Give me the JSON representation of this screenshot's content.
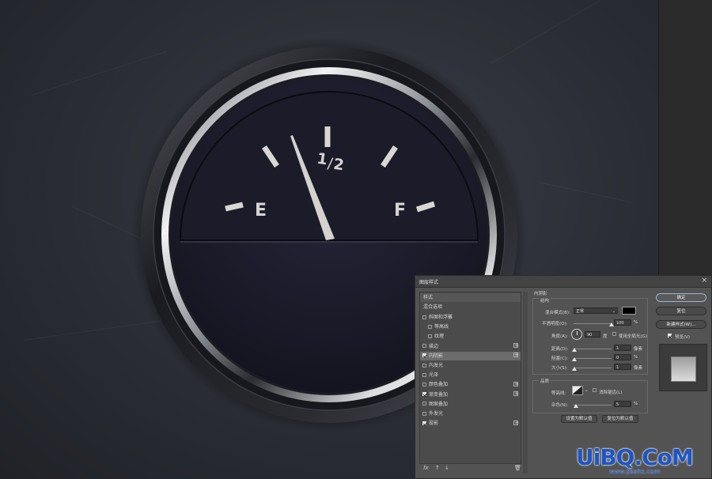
{
  "gauge": {
    "empty_label": "E",
    "full_label": "F",
    "half_numerator": "1",
    "half_slash": "/",
    "half_denominator": "2",
    "needle_level": 0.44
  },
  "dialog": {
    "title": "图层样式",
    "close": "×",
    "styles_header": "样式",
    "blend_options": "混合选项",
    "effects": [
      {
        "label": "斜面和浮雕",
        "checked": false,
        "plus": false,
        "indent": false
      },
      {
        "label": "等高线",
        "checked": false,
        "plus": false,
        "indent": true
      },
      {
        "label": "纹理",
        "checked": false,
        "plus": false,
        "indent": true
      },
      {
        "label": "描边",
        "checked": false,
        "plus": true,
        "indent": false
      },
      {
        "label": "内阴影",
        "checked": true,
        "plus": true,
        "indent": false,
        "selected": true
      },
      {
        "label": "内发光",
        "checked": false,
        "plus": false,
        "indent": false
      },
      {
        "label": "光泽",
        "checked": false,
        "plus": false,
        "indent": false
      },
      {
        "label": "颜色叠加",
        "checked": false,
        "plus": true,
        "indent": false
      },
      {
        "label": "渐变叠加",
        "checked": true,
        "plus": true,
        "indent": false
      },
      {
        "label": "图案叠加",
        "checked": false,
        "plus": false,
        "indent": false
      },
      {
        "label": "外发光",
        "checked": false,
        "plus": false,
        "indent": false
      },
      {
        "label": "投影",
        "checked": true,
        "plus": true,
        "indent": false
      }
    ],
    "fx_label": "fx",
    "section_title": "内阴影",
    "structure_title": "结构",
    "blend_mode_label": "混合模式(B):",
    "blend_mode_value": "正常",
    "opacity_label": "不透明度(O):",
    "opacity_value": "100",
    "opacity_unit": "%",
    "angle_label": "角度(A):",
    "angle_value": "90",
    "angle_unit": "度",
    "global_light_label": "使用全局光(G)",
    "distance_label": "距离(D):",
    "distance_value": "1",
    "distance_unit": "像素",
    "choke_label": "阻塞(C):",
    "choke_value": "0",
    "choke_unit": "%",
    "size_label": "大小(S):",
    "size_value": "1",
    "size_unit": "像素",
    "quality_title": "品质",
    "contour_label": "等高线:",
    "antialias_label": "消除锯齿(L)",
    "noise_label": "杂色(N):",
    "noise_value": "5",
    "noise_unit": "%",
    "set_default": "设置为默认值",
    "reset_default": "复位为默认值",
    "ok": "确定",
    "reset": "复位",
    "new_style": "新建样式(W)...",
    "preview_label": "预览(V)",
    "shadow_color": "#000000"
  },
  "watermark": {
    "brand": "UiBQ.CoM",
    "url": "www.psahz.com"
  }
}
